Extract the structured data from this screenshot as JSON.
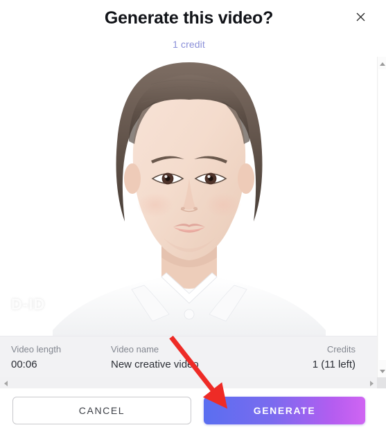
{
  "dialog": {
    "title": "Generate this video?",
    "credit_note": "1 credit",
    "close_icon": "close-icon"
  },
  "preview": {
    "watermark": "D-ID",
    "alt": "portrait of a woman facing camera on white background"
  },
  "meta": {
    "columns": [
      {
        "label": "Video length",
        "value": "00:06"
      },
      {
        "label": "Video name",
        "value": "New creative video"
      },
      {
        "label": "Credits",
        "value": "1 (11 left)"
      }
    ]
  },
  "footer": {
    "cancel_label": "CANCEL",
    "generate_label": "GENERATE"
  },
  "scrollbars": {
    "vertical_up_icon": "caret-up-icon",
    "vertical_down_icon": "caret-down-icon",
    "horizontal_left_icon": "caret-left-icon",
    "horizontal_right_icon": "caret-right-icon"
  },
  "annotation": {
    "arrow_color": "#ee2b26",
    "points_to": "GENERATE"
  },
  "colors": {
    "accent_start": "#5a6ef0",
    "accent_end": "#d065f2",
    "credit_text": "#8a8fd8",
    "meta_bar_bg": "#f2f2f4",
    "title_text": "#111318"
  }
}
